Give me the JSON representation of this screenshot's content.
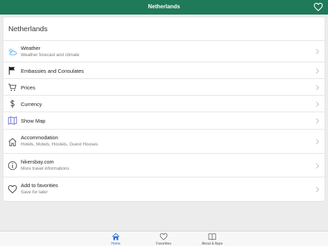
{
  "header": {
    "title": "Netherlands",
    "favorite_icon": "heart-outline-icon"
  },
  "card": {
    "title": "Netherlands"
  },
  "menu": [
    {
      "label": "Weather",
      "sub": "Weather forecast and climate",
      "icon": "weather-icon"
    },
    {
      "label": "Embassies and Consulates",
      "sub": "",
      "icon": "flag-icon"
    },
    {
      "label": "Prices",
      "sub": "",
      "icon": "cart-icon"
    },
    {
      "label": "Currency",
      "sub": "",
      "icon": "dollar-icon"
    },
    {
      "label": "Show Map",
      "sub": "",
      "icon": "map-icon"
    },
    {
      "label": "Accommodation",
      "sub": "Hotels, Motels, Hostels, Guest Houses",
      "icon": "house-icon"
    },
    {
      "label": "hikersbay.com",
      "sub": "More travel informations",
      "icon": "info-icon"
    },
    {
      "label": "Add to favorities",
      "sub": "Save for later",
      "icon": "heart-icon"
    }
  ],
  "tabs": [
    {
      "label": "Home",
      "icon": "home-icon",
      "active": true
    },
    {
      "label": "Favorities",
      "icon": "heart-icon",
      "active": false
    },
    {
      "label": "About & Apps",
      "icon": "book-icon",
      "active": false
    }
  ],
  "colors": {
    "header": "#1f7a5a",
    "active_tab": "#2f6fd6",
    "chevron": "#c7c7c7"
  }
}
